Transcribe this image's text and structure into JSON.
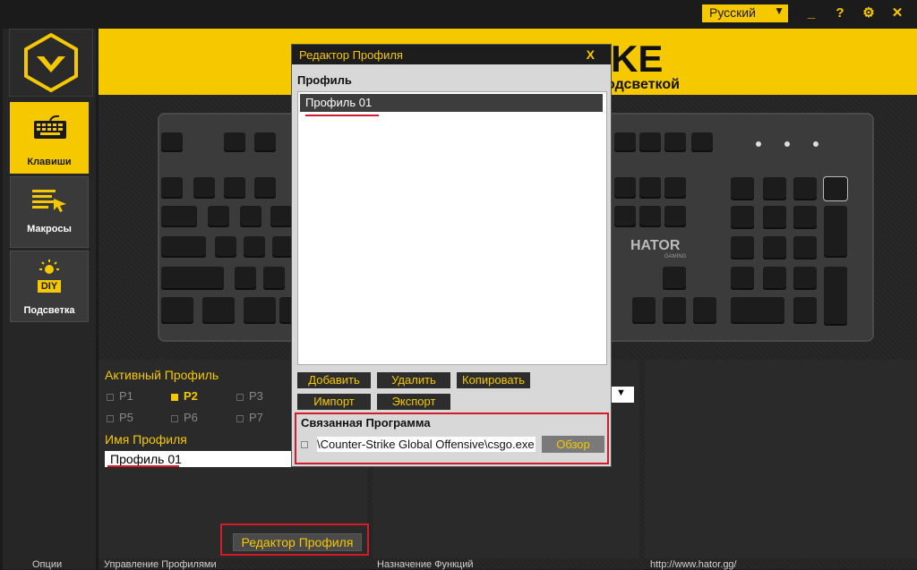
{
  "topbar": {
    "language": "Русский",
    "buttons": [
      "_",
      "?",
      "⚙",
      "✕"
    ]
  },
  "sidebar": {
    "items": [
      {
        "label": "Клавиши",
        "icon": "keyboard-icon",
        "active": true
      },
      {
        "label": "Макросы",
        "icon": "macro-icon",
        "active": false
      },
      {
        "label": "Подсветка",
        "icon": "diy-light-icon",
        "badge": "DIY",
        "active": false
      }
    ]
  },
  "banner": {
    "title": "KE",
    "subtitle": "одсветкой"
  },
  "keyboard": {
    "brand": "HATOR",
    "brand_sub": "GAMING"
  },
  "profile_panel": {
    "heading": "Активный Профиль",
    "slots": [
      "P1",
      "P2",
      "P3",
      "P5",
      "P6",
      "P7"
    ],
    "selected": "P2",
    "name_label": "Имя Профиля",
    "name_value": "Профиль 01",
    "editor_button": "Редактор Профиля"
  },
  "footer": {
    "options": "Опции",
    "profile_mgmt": "Управление Профилями",
    "func_assign": "Назначение Функций",
    "url": "http://www.hator.gg/"
  },
  "dialog": {
    "title": "Редактор Профиля",
    "close": "X",
    "profile_label": "Профиль",
    "profiles": [
      "Профиль 01"
    ],
    "buttons": {
      "add": "Добавить",
      "delete": "Удалить",
      "copy": "Копировать",
      "import": "Импорт",
      "export": "Экспорт"
    },
    "linked_label": "Связанная Программа",
    "linked_path": "\\Counter-Strike Global Offensive\\csgo.exe",
    "browse": "Обзор"
  },
  "colors": {
    "accent": "#f5c800",
    "highlight": "#d31b2a"
  }
}
